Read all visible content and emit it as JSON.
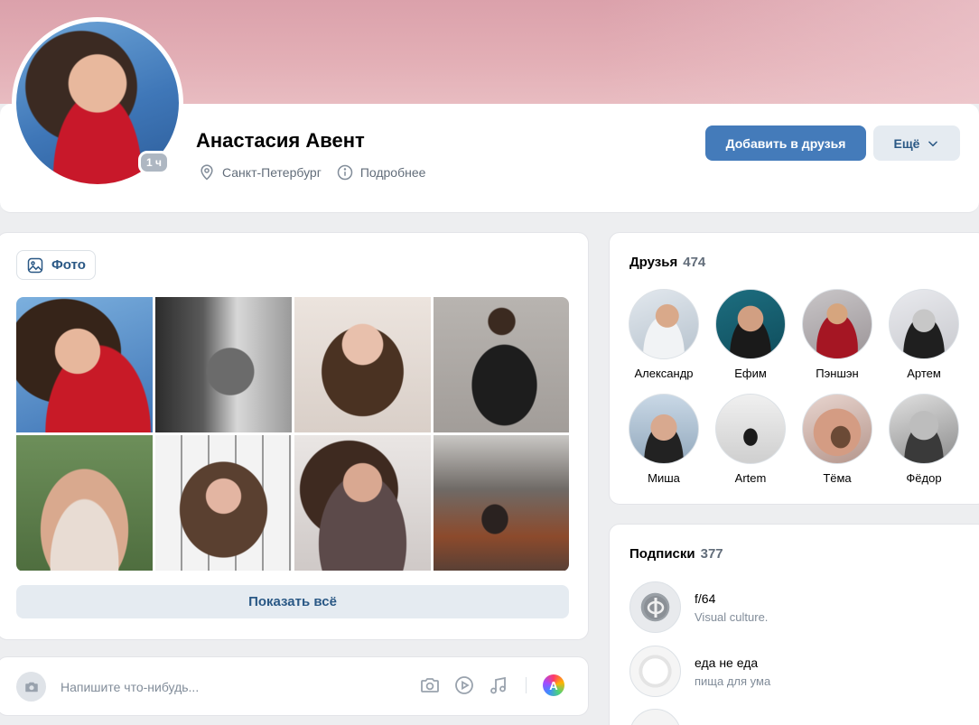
{
  "profile": {
    "name": "Анастасия Авент",
    "online_badge": "1 ч",
    "city": "Санкт-Петербург",
    "details_link": "Подробнее",
    "add_friend_label": "Добавить в друзья",
    "more_label": "Ещё"
  },
  "photos": {
    "tab_label": "Фото",
    "show_all_label": "Показать всё"
  },
  "post": {
    "placeholder": "Напишите что-нибудь...",
    "color_icon_letter": "A"
  },
  "friends": {
    "title": "Друзья",
    "count": "474",
    "items": [
      {
        "name": "Александр"
      },
      {
        "name": "Ефим"
      },
      {
        "name": "Пэншэн"
      },
      {
        "name": "Артем"
      },
      {
        "name": "Миша"
      },
      {
        "name": "Artem"
      },
      {
        "name": "Тёма"
      },
      {
        "name": "Фёдор"
      }
    ]
  },
  "subscriptions": {
    "title": "Подписки",
    "count": "377",
    "items": [
      {
        "title": "f/64",
        "subtitle": "Visual culture."
      },
      {
        "title": "еда не еда",
        "subtitle": "пища для ума"
      }
    ]
  },
  "colors": {
    "accent": "#447bba",
    "link": "#2a5885",
    "secondary_button": "#e5ebf1",
    "background": "#edeef0"
  }
}
